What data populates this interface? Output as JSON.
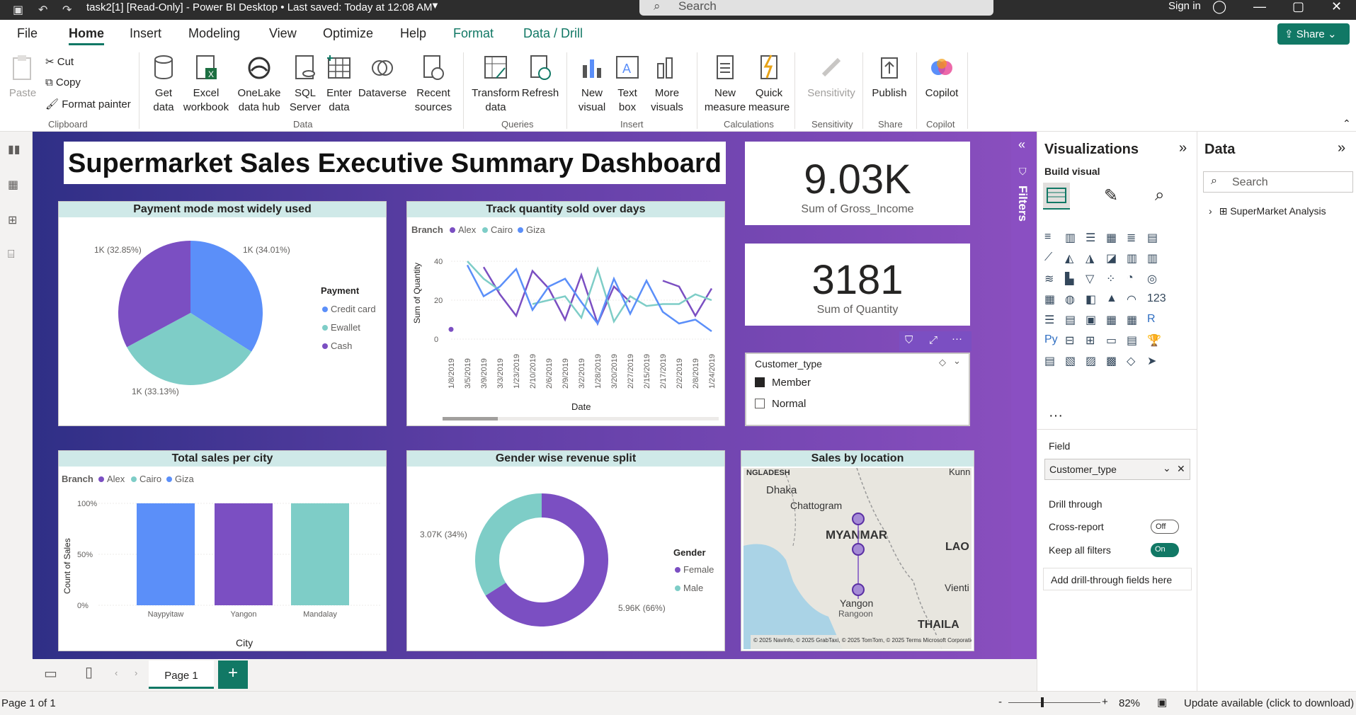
{
  "titlebar": {
    "title": "task2[1] [Read-Only] - Power BI Desktop • Last saved: Today at 12:08 AM",
    "search": "Search",
    "signin": "Sign in"
  },
  "menu": {
    "tabs": [
      "File",
      "Home",
      "Insert",
      "Modeling",
      "View",
      "Optimize",
      "Help",
      "Format",
      "Data / Drill"
    ],
    "share": "Share"
  },
  "ribbon": {
    "paste": "Paste",
    "cut": "Cut",
    "copy": "Copy",
    "format_painter": "Format painter",
    "get_data": "Get data",
    "excel": "Excel workbook",
    "onelake": "OneLake data hub",
    "sql": "SQL Server",
    "enter": "Enter data",
    "dataverse": "Dataverse",
    "recent": "Recent sources",
    "transform": "Transform data",
    "refresh": "Refresh",
    "new_visual": "New visual",
    "text_box": "Text box",
    "more_visuals": "More visuals",
    "new_measure": "New measure",
    "quick_measure": "Quick measure",
    "sensitivity": "Sensitivity",
    "publish": "Publish",
    "copilot": "Copilot",
    "groups": {
      "clipboard": "Clipboard",
      "data": "Data",
      "queries": "Queries",
      "insert": "Insert",
      "calculations": "Calculations",
      "sensitivity": "Sensitivity",
      "share": "Share",
      "copilot": "Copilot"
    }
  },
  "dashboard": {
    "title": "Supermarket Sales Executive Summary Dashboard",
    "kpi1": {
      "value": "9.03K",
      "label": "Sum of Gross_Income"
    },
    "kpi2": {
      "value": "3181",
      "label": "Sum of Quantity"
    },
    "slicer": {
      "title": "Customer_type",
      "options": [
        "Member",
        "Normal"
      ]
    },
    "pie": {
      "title": "Payment mode most widely used",
      "legend_title": "Payment",
      "legend": [
        "Credit card",
        "Ewallet",
        "Cash"
      ],
      "labels": [
        "1K (34.01%)",
        "1K (33.13%)",
        "1K (32.85%)"
      ]
    },
    "line": {
      "title": "Track quantity sold over days",
      "legend_title": "Branch",
      "legend": [
        "Alex",
        "Cairo",
        "Giza"
      ],
      "ylabel": "Sum of Quantity",
      "xlabel": "Date",
      "yticks": [
        "40",
        "20",
        "0"
      ],
      "dates": [
        "1/8/2019",
        "3/5/2019",
        "3/9/2019",
        "3/3/2019",
        "1/23/2019",
        "2/10/2019",
        "2/6/2019",
        "2/9/2019",
        "3/2/2019",
        "1/28/2019",
        "3/20/2019",
        "2/27/2019",
        "2/15/2019",
        "2/17/2019",
        "2/2/2019",
        "2/8/2019",
        "1/24/2019"
      ]
    },
    "bar": {
      "title": "Total sales per city",
      "legend_title": "Branch",
      "legend": [
        "Alex",
        "Cairo",
        "Giza"
      ],
      "ylabel": "Count of Sales",
      "xlabel": "City",
      "yticks": [
        "100%",
        "50%",
        "0%"
      ],
      "categories": [
        "Naypyitaw",
        "Yangon",
        "Mandalay"
      ]
    },
    "donut": {
      "title": "Gender wise revenue split",
      "legend_title": "Gender",
      "legend": [
        "Female",
        "Male"
      ],
      "labels": [
        "3.07K (34%)",
        "5.96K (66%)"
      ]
    },
    "map": {
      "title": "Sales by location",
      "places": [
        "NGLADESH",
        "Dhaka",
        "Chattogram",
        "MYANMAR",
        "LAO",
        "Yangon",
        "Rangoon",
        "Vienti",
        "THAILA",
        "Kunn"
      ],
      "attribution": "© 2025 NavInfo, © 2025 GrabTaxi, © 2025 TomTom, © 2025 Terms Microsoft Corporation, © OpenStreetMap"
    }
  },
  "chart_data": [
    {
      "type": "pie",
      "title": "Payment mode most widely used",
      "categories": [
        "Credit card",
        "Ewallet",
        "Cash"
      ],
      "values": [
        34.01,
        33.13,
        32.85
      ],
      "colors": [
        "#5b8ff9",
        "#7ecdc7",
        "#7b4fc2"
      ]
    },
    {
      "type": "line",
      "title": "Track quantity sold over days",
      "xlabel": "Date",
      "ylabel": "Sum of Quantity",
      "ylim": [
        0,
        40
      ],
      "x": [
        "1/8/2019",
        "3/5/2019",
        "3/9/2019",
        "3/3/2019",
        "1/23/2019",
        "2/10/2019",
        "2/6/2019",
        "2/9/2019",
        "3/2/2019",
        "1/28/2019",
        "3/20/2019",
        "2/27/2019",
        "2/15/2019",
        "2/17/2019",
        "2/2/2019",
        "2/8/2019",
        "1/24/2019"
      ],
      "series": [
        {
          "name": "Alex",
          "color": "#7b4fc2",
          "values": [
            5,
            null,
            37,
            23,
            12,
            35,
            26,
            10,
            33,
            8,
            27,
            19,
            null,
            30,
            27,
            12,
            26
          ]
        },
        {
          "name": "Cairo",
          "color": "#7ecdc7",
          "values": [
            null,
            40,
            31,
            25,
            null,
            18,
            20,
            22,
            11,
            36,
            9,
            22,
            17,
            18,
            18,
            23,
            20
          ]
        },
        {
          "name": "Giza",
          "color": "#5b8ff9",
          "values": [
            null,
            38,
            22,
            27,
            36,
            15,
            27,
            31,
            19,
            8,
            31,
            13,
            30,
            14,
            8,
            10,
            4
          ]
        }
      ]
    },
    {
      "type": "bar",
      "title": "Total sales per city",
      "xlabel": "City",
      "ylabel": "Count of Sales",
      "ylim": [
        0,
        100
      ],
      "categories": [
        "Naypyitaw",
        "Yangon",
        "Mandalay"
      ],
      "series": [
        {
          "name": "Giza",
          "values": [
            100
          ]
        },
        {
          "name": "Alex",
          "values": [
            100
          ]
        },
        {
          "name": "Cairo",
          "values": [
            100
          ]
        }
      ],
      "colors": [
        "#5b8ff9",
        "#7b4fc2",
        "#7ecdc7"
      ]
    },
    {
      "type": "pie",
      "title": "Gender wise revenue split",
      "categories": [
        "Female",
        "Male"
      ],
      "values": [
        66,
        34
      ],
      "colors": [
        "#7b4fc2",
        "#7ecdc7"
      ]
    }
  ],
  "viz": {
    "title": "Visualizations",
    "build": "Build visual",
    "field_label": "Field",
    "field_value": "Customer_type",
    "drill": "Drill through",
    "cross": "Cross-report",
    "cross_state": "Off",
    "keep": "Keep all filters",
    "keep_state": "On",
    "add": "Add drill-through fields here",
    "filters": "Filters"
  },
  "data": {
    "title": "Data",
    "search": "Search",
    "item": "SuperMarket Analysis"
  },
  "pages": {
    "page": "Page 1"
  },
  "status": {
    "left": "Page 1 of 1",
    "zoom": "82%",
    "update": "Update available (click to download)"
  }
}
